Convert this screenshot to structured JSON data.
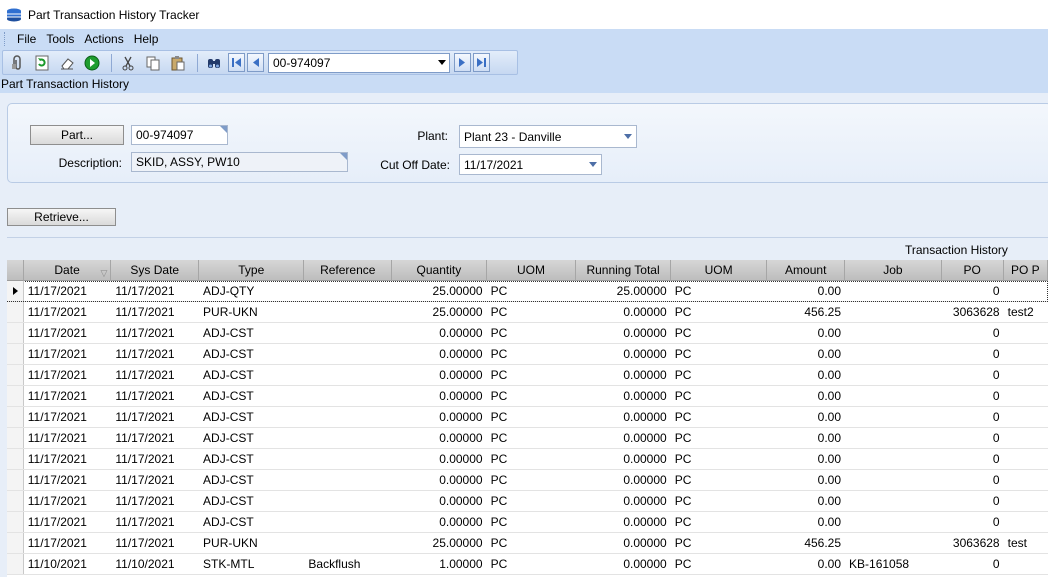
{
  "window": {
    "title": "Part Transaction History Tracker"
  },
  "menu": [
    "File",
    "Tools",
    "Actions",
    "Help"
  ],
  "toolbar": {
    "part_combo_value": "00-974097",
    "icons": [
      "attach-icon",
      "refresh-icon",
      "eraser-icon",
      "go-icon",
      "cut-icon",
      "copy-icon",
      "paste-icon",
      "binoculars-icon",
      "first-record-icon",
      "previous-record-icon",
      "next-record-icon",
      "last-record-icon"
    ]
  },
  "section_title": "Part Transaction History",
  "filters": {
    "part_button": "Part...",
    "part_value": "00-974097",
    "description_label": "Description:",
    "description_value": "SKID, ASSY, PW10",
    "plant_label": "Plant:",
    "plant_value": "Plant 23 - Danville",
    "cutoff_label": "Cut Off Date:",
    "cutoff_value": "11/17/2021",
    "retrieve_button": "Retrieve..."
  },
  "grid": {
    "caption": "Transaction History",
    "columns": [
      "Date",
      "Sys Date",
      "Type",
      "Reference",
      "Quantity",
      "UOM",
      "Running Total",
      "UOM",
      "Amount",
      "Job",
      "PO",
      "PO P"
    ],
    "rows": [
      [
        "11/17/2021",
        "11/17/2021",
        "ADJ-QTY",
        "",
        "25.00000",
        "PC",
        "25.00000",
        "PC",
        "0.00",
        "",
        "0",
        ""
      ],
      [
        "11/17/2021",
        "11/17/2021",
        "PUR-UKN",
        "",
        "25.00000",
        "PC",
        "0.00000",
        "PC",
        "456.25",
        "",
        "3063628",
        "test2"
      ],
      [
        "11/17/2021",
        "11/17/2021",
        "ADJ-CST",
        "",
        "0.00000",
        "PC",
        "0.00000",
        "PC",
        "0.00",
        "",
        "0",
        ""
      ],
      [
        "11/17/2021",
        "11/17/2021",
        "ADJ-CST",
        "",
        "0.00000",
        "PC",
        "0.00000",
        "PC",
        "0.00",
        "",
        "0",
        ""
      ],
      [
        "11/17/2021",
        "11/17/2021",
        "ADJ-CST",
        "",
        "0.00000",
        "PC",
        "0.00000",
        "PC",
        "0.00",
        "",
        "0",
        ""
      ],
      [
        "11/17/2021",
        "11/17/2021",
        "ADJ-CST",
        "",
        "0.00000",
        "PC",
        "0.00000",
        "PC",
        "0.00",
        "",
        "0",
        ""
      ],
      [
        "11/17/2021",
        "11/17/2021",
        "ADJ-CST",
        "",
        "0.00000",
        "PC",
        "0.00000",
        "PC",
        "0.00",
        "",
        "0",
        ""
      ],
      [
        "11/17/2021",
        "11/17/2021",
        "ADJ-CST",
        "",
        "0.00000",
        "PC",
        "0.00000",
        "PC",
        "0.00",
        "",
        "0",
        ""
      ],
      [
        "11/17/2021",
        "11/17/2021",
        "ADJ-CST",
        "",
        "0.00000",
        "PC",
        "0.00000",
        "PC",
        "0.00",
        "",
        "0",
        ""
      ],
      [
        "11/17/2021",
        "11/17/2021",
        "ADJ-CST",
        "",
        "0.00000",
        "PC",
        "0.00000",
        "PC",
        "0.00",
        "",
        "0",
        ""
      ],
      [
        "11/17/2021",
        "11/17/2021",
        "ADJ-CST",
        "",
        "0.00000",
        "PC",
        "0.00000",
        "PC",
        "0.00",
        "",
        "0",
        ""
      ],
      [
        "11/17/2021",
        "11/17/2021",
        "ADJ-CST",
        "",
        "0.00000",
        "PC",
        "0.00000",
        "PC",
        "0.00",
        "",
        "0",
        ""
      ],
      [
        "11/17/2021",
        "11/17/2021",
        "PUR-UKN",
        "",
        "25.00000",
        "PC",
        "0.00000",
        "PC",
        "456.25",
        "",
        "3063628",
        "test"
      ],
      [
        "11/10/2021",
        "11/10/2021",
        "STK-MTL",
        "Backflush",
        "1.00000",
        "PC",
        "0.00000",
        "PC",
        "0.00",
        "KB-161058",
        "0",
        ""
      ]
    ]
  }
}
